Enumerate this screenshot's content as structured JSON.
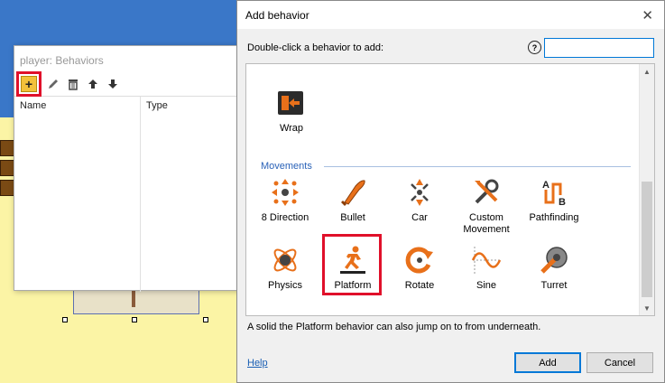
{
  "behaviors_window": {
    "title": "player: Behaviors",
    "columns": [
      "Name",
      "Type"
    ]
  },
  "dialog": {
    "title": "Add behavior",
    "close_glyph": "✕",
    "prompt": "Double-click a behavior to add:",
    "help_glyph": "?",
    "search": {
      "value": "",
      "placeholder": ""
    },
    "top_items": [
      {
        "label": "Wrap",
        "icon": "wrap-icon"
      }
    ],
    "category": "Movements",
    "items": [
      {
        "label": "8 Direction",
        "icon": "eight-direction-icon"
      },
      {
        "label": "Bullet",
        "icon": "bullet-icon"
      },
      {
        "label": "Car",
        "icon": "car-icon"
      },
      {
        "label": "Custom Movement",
        "icon": "custom-movement-icon"
      },
      {
        "label": "Pathfinding",
        "icon": "pathfinding-icon"
      },
      {
        "label": "Physics",
        "icon": "physics-icon"
      },
      {
        "label": "Platform",
        "icon": "platform-icon",
        "selected": true
      },
      {
        "label": "Rotate",
        "icon": "rotate-icon"
      },
      {
        "label": "Sine",
        "icon": "sine-icon"
      },
      {
        "label": "Turret",
        "icon": "turret-icon"
      }
    ],
    "description": "A solid the Platform behavior can also jump on to from underneath.",
    "help_link": "Help",
    "add_label": "Add",
    "cancel_label": "Cancel"
  },
  "colors": {
    "highlight_red": "#e0102a",
    "accent_blue": "#0078d7",
    "category_blue": "#2a62b8",
    "icon_orange": "#e8701a"
  }
}
